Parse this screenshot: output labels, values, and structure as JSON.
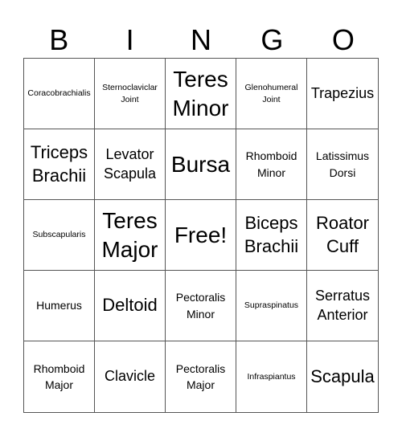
{
  "header": [
    "B",
    "I",
    "N",
    "G",
    "O"
  ],
  "cells": [
    {
      "text": "Coracobrachialis",
      "size": "s1"
    },
    {
      "text": "Sternoclaviclar Joint",
      "size": "s1"
    },
    {
      "text": "Teres Minor",
      "size": "s5"
    },
    {
      "text": "Glenohumeral Joint",
      "size": "s1"
    },
    {
      "text": "Trapezius",
      "size": "s3"
    },
    {
      "text": "Triceps Brachii",
      "size": "s4"
    },
    {
      "text": "Levator Scapula",
      "size": "s3"
    },
    {
      "text": "Bursa",
      "size": "s5"
    },
    {
      "text": "Rhomboid Minor",
      "size": "s2"
    },
    {
      "text": "Latissimus Dorsi",
      "size": "s2"
    },
    {
      "text": "Subscapularis",
      "size": "s1"
    },
    {
      "text": "Teres Major",
      "size": "s5"
    },
    {
      "text": "Free!",
      "size": "s5"
    },
    {
      "text": "Biceps Brachii",
      "size": "s4"
    },
    {
      "text": "Roator Cuff",
      "size": "s4"
    },
    {
      "text": "Humerus",
      "size": "s2"
    },
    {
      "text": "Deltoid",
      "size": "s4"
    },
    {
      "text": "Pectoralis Minor",
      "size": "s2"
    },
    {
      "text": "Supraspinatus",
      "size": "s1"
    },
    {
      "text": "Serratus Anterior",
      "size": "s3"
    },
    {
      "text": "Rhomboid Major",
      "size": "s2"
    },
    {
      "text": "Clavicle",
      "size": "s3"
    },
    {
      "text": "Pectoralis Major",
      "size": "s2"
    },
    {
      "text": "Infraspiantus",
      "size": "s1"
    },
    {
      "text": "Scapula",
      "size": "s4"
    }
  ]
}
